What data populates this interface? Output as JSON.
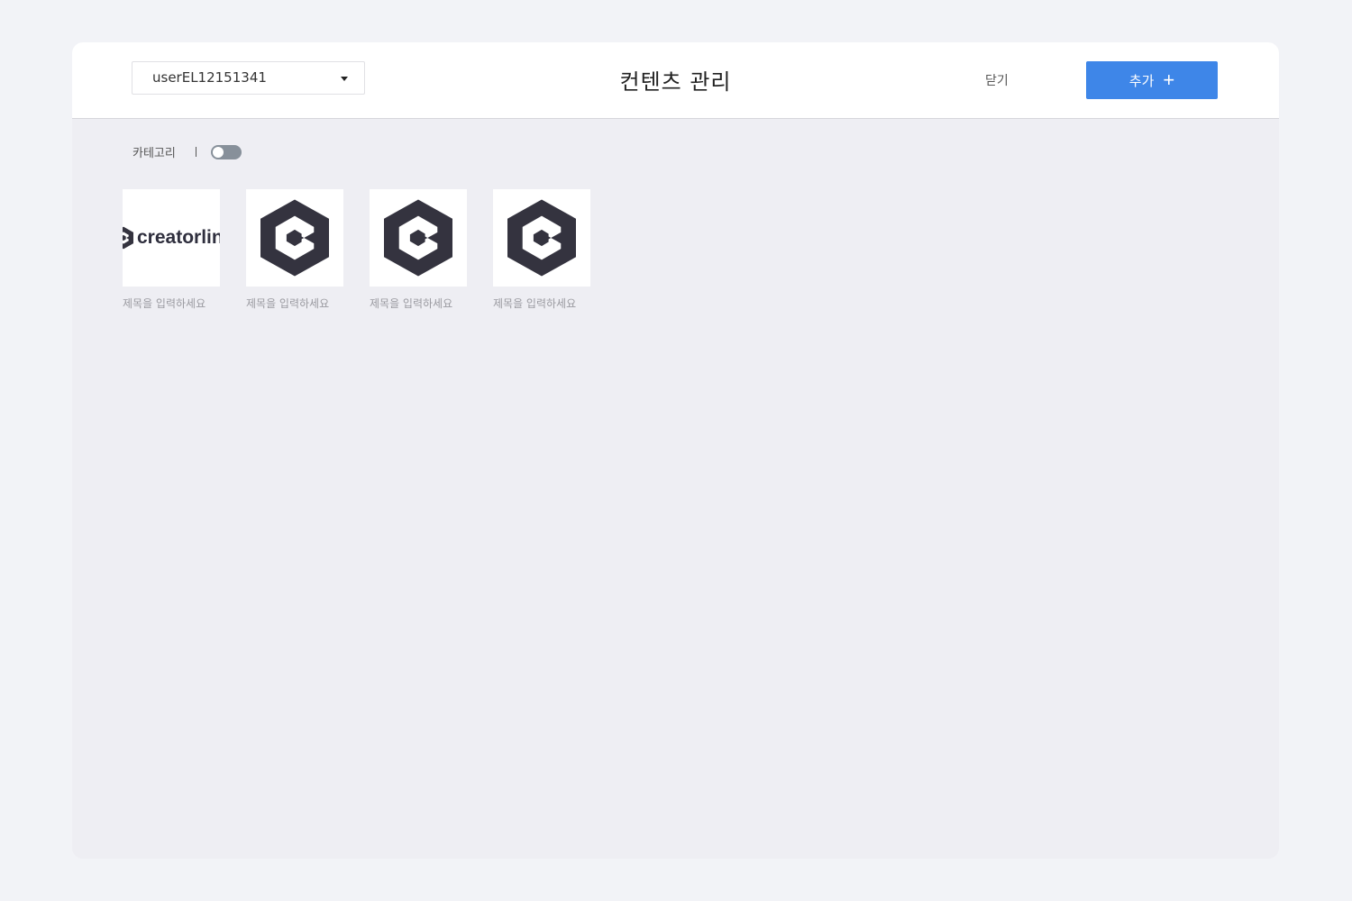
{
  "header": {
    "user_select_value": "userEL12151341",
    "title": "컨텐츠 관리",
    "close_label": "닫기",
    "add_label": "추가",
    "add_icon": "+"
  },
  "filter": {
    "category_label": "카테고리",
    "category_toggle_on": false
  },
  "contents": [
    {
      "title": "제목을 입력하세요",
      "thumbnail": "creatorlink-wordmark",
      "wordmark": "creatorlin"
    },
    {
      "title": "제목을 입력하세요",
      "thumbnail": "creatorlink-logo-icon"
    },
    {
      "title": "제목을 입력하세요",
      "thumbnail": "creatorlink-logo-icon"
    },
    {
      "title": "제목을 입력하세요",
      "thumbnail": "creatorlink-logo-icon"
    }
  ],
  "colors": {
    "accent": "#3e86e8",
    "logo": "#34333f",
    "background": "#eeeef3"
  }
}
